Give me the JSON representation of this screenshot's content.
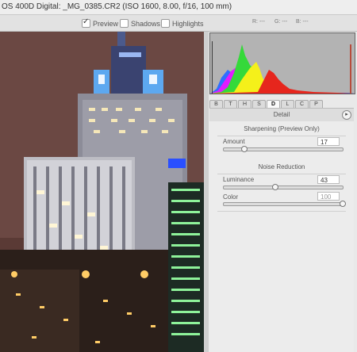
{
  "title": "OS 400D Digital:  _MG_0385.CR2  (ISO 1600, 8.00, f/16, 100 mm)",
  "toolbar": {
    "preview": {
      "label": "Preview",
      "checked": true
    },
    "shadows": {
      "label": "Shadows",
      "checked": false
    },
    "highlights": {
      "label": "Highlights",
      "checked": false
    }
  },
  "rgb_readout": {
    "r": "R: ---",
    "g": "G: ---",
    "b": "B: ---"
  },
  "tabs": [
    "B",
    "T",
    "H",
    "S",
    "D",
    "L",
    "C",
    "P"
  ],
  "active_tab": "D",
  "panel": {
    "title": "Detail",
    "sharpening_title": "Sharpening  (Preview Only)",
    "amount_label": "Amount",
    "amount_value": "17",
    "amount_level": 0.17,
    "noise_title": "Noise Reduction",
    "luminance_label": "Luminance",
    "luminance_value": "43",
    "luminance_level": 0.43,
    "color_label": "Color",
    "color_value": "100",
    "color_level": 1.0
  },
  "icons": {
    "panel_menu": "circle-arrow-right-icon"
  }
}
